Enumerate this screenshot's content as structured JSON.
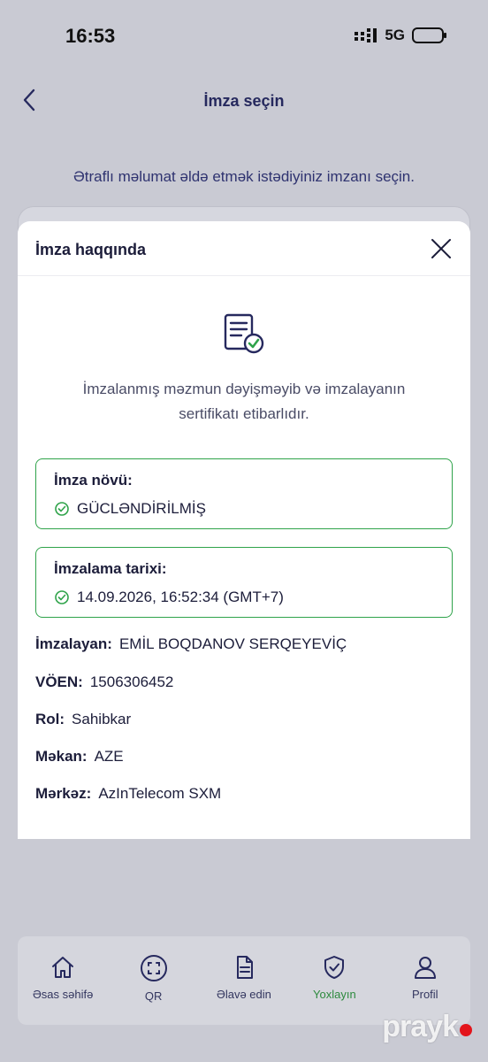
{
  "status_bar": {
    "time": "16:53",
    "network": "5G"
  },
  "nav": {
    "title": "İmza seçin"
  },
  "instruction": "Ətraflı məlumat əldə etmək istədiyiniz imzanı seçin.",
  "modal": {
    "title": "İmza haqqında",
    "summary_line1": "İmzalanmış məzmun dəyişməyib və imzalayanın",
    "summary_line2": "sertifikatı etibarlıdır.",
    "signature_type": {
      "label": "İmza növü:",
      "value": "GÜCLƏNDİRİLMİŞ"
    },
    "signing_date": {
      "label": "İmzalama tarixi:",
      "value": "14.09.2026, 16:52:34 (GMT+7)"
    },
    "details": [
      {
        "key": "İmzalayan:",
        "value": "EMİL BOQDANOV SERQEYEVİÇ"
      },
      {
        "key": "VÖEN:",
        "value": "1506306452"
      },
      {
        "key": "Rol:",
        "value": "Sahibkar"
      },
      {
        "key": "Məkan:",
        "value": "AZE"
      },
      {
        "key": "Mərkəz:",
        "value": "AzInTelecom SXM"
      }
    ]
  },
  "tabs": [
    {
      "label": "Əsas səhifə",
      "icon": "home-icon"
    },
    {
      "label": "QR",
      "icon": "qr-scan-icon"
    },
    {
      "label": "Əlavə edin",
      "icon": "document-icon"
    },
    {
      "label": "Yoxlayın",
      "icon": "shield-check-icon",
      "active": true
    },
    {
      "label": "Profil",
      "icon": "user-icon"
    }
  ],
  "watermark": "prayk",
  "colors": {
    "accent_green": "#2fa34a",
    "navy": "#26295e",
    "background": "#c9cad3"
  }
}
